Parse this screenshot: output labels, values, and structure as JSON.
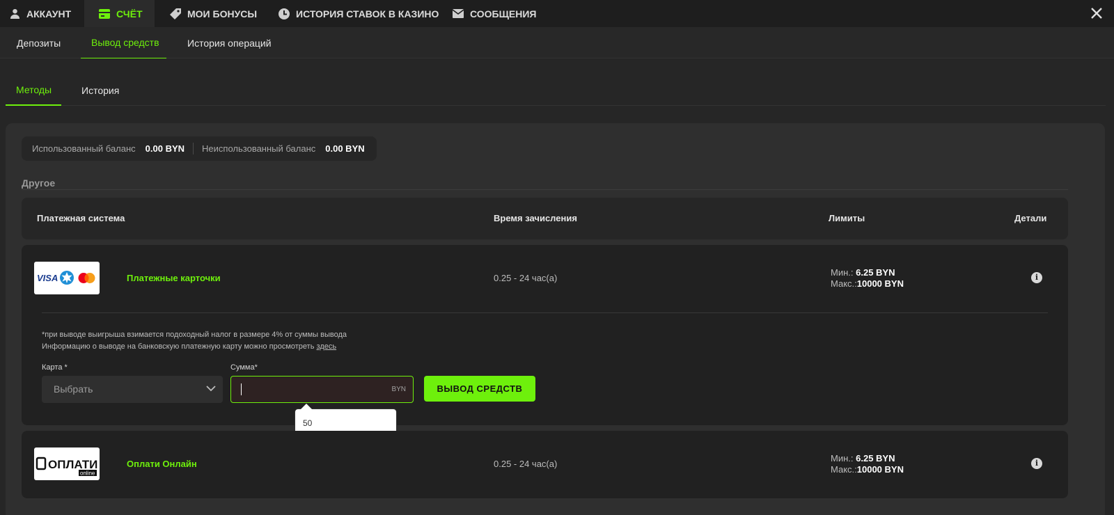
{
  "top_tabs": [
    {
      "label": "Аккаунт",
      "icon": "user-icon"
    },
    {
      "label": "Счёт",
      "icon": "wallet-icon"
    },
    {
      "label": "Мои бонусы",
      "icon": "tag-icon"
    },
    {
      "label": "История ставок в казино",
      "icon": "clock-icon"
    },
    {
      "label": "Сообщения",
      "icon": "envelope-icon"
    }
  ],
  "sub_tabs": [
    {
      "label": "Депозиты"
    },
    {
      "label": "Вывод средств"
    },
    {
      "label": "История операций"
    }
  ],
  "method_tabs": [
    {
      "label": "Методы"
    },
    {
      "label": "История"
    }
  ],
  "balance": {
    "used_label": "Использованный баланс",
    "used_value": "0.00 BYN",
    "unused_label": "Неиспользованный баланс",
    "unused_value": "0.00 BYN"
  },
  "section_title": "Другое",
  "table_headers": {
    "system": "Платежная система",
    "time": "Время зачисления",
    "limits": "Лимиты",
    "details": "Детали"
  },
  "methods": [
    {
      "name": "Платежные карточки",
      "logo_text": "VISA",
      "time": "0.25 - 24 час(а)",
      "min_label": "Мин.:",
      "min_value": "6.25 BYN",
      "max_label": "Макс.:",
      "max_value": "10000 BYN",
      "note_line1": "*при выводе выигрыша взимается подоходный налог в размере 4% от суммы вывода",
      "note_line2": "Информацию о выводе на банковскую платежную карту можно просмотреть",
      "note_link": "здесь",
      "card_label": "Карта *",
      "card_placeholder": "Выбрать",
      "amount_label": "Сумма*",
      "amount_currency": "BYN",
      "withdraw_button": "Вывод средств",
      "suggestion": "50"
    },
    {
      "name": "Оплати Онлайн",
      "logo_text": "ОПЛАТИ",
      "logo_sub": "online",
      "time": "0.25 - 24 час(а)",
      "min_label": "Мин.:",
      "min_value": "6.25 BYN",
      "max_label": "Макс.:",
      "max_value": "10000 BYN"
    }
  ],
  "colors": {
    "accent": "#6ef00c",
    "background": "#262626",
    "card": "#212121"
  }
}
